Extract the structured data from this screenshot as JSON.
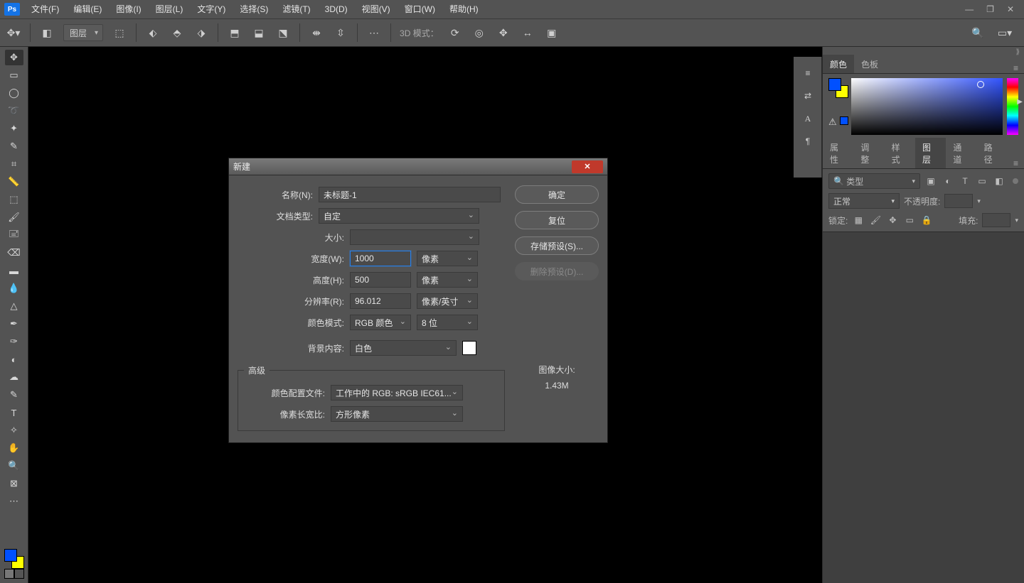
{
  "menubar": {
    "logo": "Ps",
    "items": [
      "文件(F)",
      "编辑(E)",
      "图像(I)",
      "图层(L)",
      "文字(Y)",
      "选择(S)",
      "滤镜(T)",
      "3D(D)",
      "视图(V)",
      "窗口(W)",
      "帮助(H)"
    ]
  },
  "optbar": {
    "layer_combo": "图层",
    "mode_label": "3D 模式："
  },
  "tools": [
    {
      "name": "move-tool",
      "glyph": "✥"
    },
    {
      "name": "marquee-rect-tool",
      "glyph": "▭"
    },
    {
      "name": "marquee-ellipse-tool",
      "glyph": "◯"
    },
    {
      "name": "lasso-tool",
      "glyph": "➰"
    },
    {
      "name": "magic-wand-tool",
      "glyph": "✦"
    },
    {
      "name": "eyedropper-tool",
      "glyph": "✎"
    },
    {
      "name": "crop-tool",
      "glyph": "⌗"
    },
    {
      "name": "ruler-tool",
      "glyph": "📏"
    },
    {
      "name": "frame-tool",
      "glyph": "⬚"
    },
    {
      "name": "brush-tool",
      "glyph": "🖌"
    },
    {
      "name": "stamp-tool",
      "glyph": "🖃"
    },
    {
      "name": "eraser-tool",
      "glyph": "⌫"
    },
    {
      "name": "gradient-tool",
      "glyph": "▬"
    },
    {
      "name": "blur-tool",
      "glyph": "💧"
    },
    {
      "name": "sharpen-tool",
      "glyph": "△"
    },
    {
      "name": "pen-tool",
      "glyph": "✒"
    },
    {
      "name": "freeform-pen-tool",
      "glyph": "✑"
    },
    {
      "name": "dodge-tool",
      "glyph": "◐"
    },
    {
      "name": "sponge-tool",
      "glyph": "☁"
    },
    {
      "name": "path-tool",
      "glyph": "✎"
    },
    {
      "name": "type-tool",
      "glyph": "T"
    },
    {
      "name": "shape-tool",
      "glyph": "✧"
    },
    {
      "name": "hand-tool",
      "glyph": "✋"
    },
    {
      "name": "zoom-tool",
      "glyph": "🔍"
    },
    {
      "name": "artboard-tool",
      "glyph": "⊠"
    },
    {
      "name": "more-tools",
      "glyph": "⋯"
    }
  ],
  "mini_icons": [
    {
      "name": "brush-presets-icon",
      "glyph": "≡"
    },
    {
      "name": "adjust-icon",
      "glyph": "⇄"
    },
    {
      "name": "paragraph-icon",
      "glyph": "A"
    },
    {
      "name": "glyphs-icon",
      "glyph": "¶"
    }
  ],
  "right": {
    "color_tabs": [
      "颜色",
      "色板"
    ],
    "color_active": 0,
    "lower_tabs": [
      "属性",
      "调整",
      "样式",
      "图层",
      "通道",
      "路径"
    ],
    "lower_active": 3,
    "layers": {
      "kind_search_glyph": "🔍",
      "kind_label": "类型",
      "filter_icons": [
        "▣",
        "◐",
        "T",
        "▭",
        "◧"
      ],
      "blend_label": "正常",
      "opacity_label": "不透明度:",
      "lock_label": "锁定:",
      "fill_label": "填充:",
      "lock_icons": [
        "▦",
        "🖌",
        "✥",
        "▭",
        "🔒"
      ]
    }
  },
  "dialog": {
    "title": "新建",
    "name_label": "名称(N):",
    "name_value": "未标题-1",
    "preset_label": "文档类型:",
    "preset_value": "自定",
    "size_label": "大小:",
    "width_label": "宽度(W):",
    "width_value": "1000",
    "width_unit": "像素",
    "height_label": "高度(H):",
    "height_value": "500",
    "height_unit": "像素",
    "res_label": "分辨率(R):",
    "res_value": "96.012",
    "res_unit": "像素/英寸",
    "mode_label": "颜色模式:",
    "mode_value": "RGB 颜色",
    "depth_value": "8 位",
    "bg_label": "背景内容:",
    "bg_value": "白色",
    "adv_label": "高级",
    "profile_label": "颜色配置文件:",
    "profile_value": "工作中的 RGB: sRGB IEC61...",
    "ratio_label": "像素长宽比:",
    "ratio_value": "方形像素",
    "btn_ok": "确定",
    "btn_cancel": "复位",
    "btn_save_preset": "存储预设(S)...",
    "btn_delete_preset": "删除预设(D)...",
    "size_caption": "图像大小:",
    "size_value": "1.43M"
  }
}
